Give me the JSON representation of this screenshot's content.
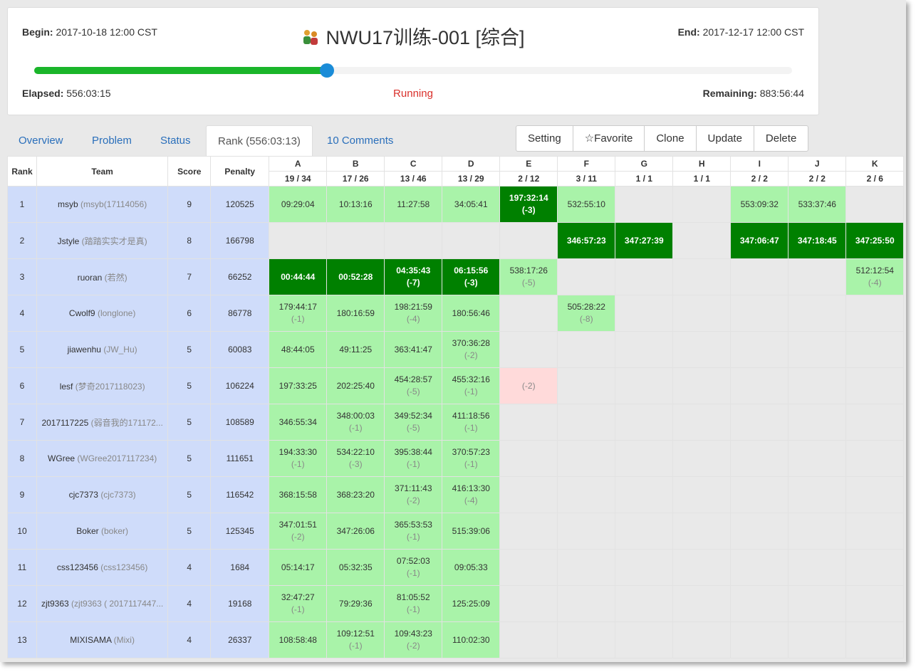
{
  "contest": {
    "title": "NWU17训练-001 [综合]",
    "begin_label": "Begin:",
    "begin": "2017-10-18 12:00 CST",
    "end_label": "End:",
    "end": "2017-12-17 12:00 CST",
    "elapsed_label": "Elapsed:",
    "elapsed": "556:03:15",
    "remaining_label": "Remaining:",
    "remaining": "883:56:44",
    "status": "Running",
    "progress": 0.386
  },
  "tabs": [
    {
      "label": "Overview"
    },
    {
      "label": "Problem"
    },
    {
      "label": "Status"
    },
    {
      "label": "Rank (556:03:13)"
    },
    {
      "label": "10 Comments"
    }
  ],
  "buttons": [
    {
      "label": "Setting"
    },
    {
      "label": "☆Favorite"
    },
    {
      "label": "Clone"
    },
    {
      "label": "Update"
    },
    {
      "label": "Delete"
    }
  ],
  "columns": {
    "rank": "Rank",
    "team": "Team",
    "score": "Score",
    "penalty": "Penalty"
  },
  "problems": [
    {
      "id": "A",
      "stat": "19 / 34"
    },
    {
      "id": "B",
      "stat": "17 / 26"
    },
    {
      "id": "C",
      "stat": "13 / 46"
    },
    {
      "id": "D",
      "stat": "13 / 29"
    },
    {
      "id": "E",
      "stat": "2 / 12"
    },
    {
      "id": "F",
      "stat": "3 / 11"
    },
    {
      "id": "G",
      "stat": "1 / 1"
    },
    {
      "id": "H",
      "stat": "1 / 1"
    },
    {
      "id": "I",
      "stat": "2 / 2"
    },
    {
      "id": "J",
      "stat": "2 / 2"
    },
    {
      "id": "K",
      "stat": "2 / 6"
    }
  ],
  "rows": [
    {
      "rank": "1",
      "user": "msyb",
      "nick": "(msyb(17114056)",
      "score": "9",
      "penalty": "120525",
      "cells": [
        [
          "ac",
          "09:29:04",
          ""
        ],
        [
          "ac",
          "10:13:16",
          ""
        ],
        [
          "ac",
          "11:27:58",
          ""
        ],
        [
          "ac",
          "34:05:41",
          ""
        ],
        [
          "fb",
          "197:32:14",
          "(-3)"
        ],
        [
          "ac",
          "532:55:10",
          ""
        ],
        [
          "",
          "",
          ""
        ],
        [
          "",
          "",
          ""
        ],
        [
          "ac",
          "553:09:32",
          ""
        ],
        [
          "ac",
          "533:37:46",
          ""
        ],
        [
          "",
          "",
          ""
        ]
      ]
    },
    {
      "rank": "2",
      "user": "Jstyle",
      "nick": "(踏踏实实才是真)",
      "score": "8",
      "penalty": "166798",
      "cells": [
        [
          "",
          "",
          ""
        ],
        [
          "",
          "",
          ""
        ],
        [
          "",
          "",
          ""
        ],
        [
          "",
          "",
          ""
        ],
        [
          "",
          "",
          ""
        ],
        [
          "fb",
          "346:57:23",
          ""
        ],
        [
          "fb",
          "347:27:39",
          ""
        ],
        [
          "",
          "",
          ""
        ],
        [
          "fb",
          "347:06:47",
          ""
        ],
        [
          "fb",
          "347:18:45",
          ""
        ],
        [
          "fb",
          "347:25:50",
          ""
        ]
      ]
    },
    {
      "rank": "3",
      "user": "ruoran",
      "nick": "(若然)",
      "score": "7",
      "penalty": "66252",
      "cells": [
        [
          "fb",
          "00:44:44",
          ""
        ],
        [
          "fb",
          "00:52:28",
          ""
        ],
        [
          "fb",
          "04:35:43",
          "(-7)"
        ],
        [
          "fb",
          "06:15:56",
          "(-3)"
        ],
        [
          "ac",
          "538:17:26",
          "(-5)"
        ],
        [
          "",
          "",
          ""
        ],
        [
          "",
          "",
          ""
        ],
        [
          "",
          "",
          ""
        ],
        [
          "",
          "",
          ""
        ],
        [
          "",
          "",
          ""
        ],
        [
          "ac",
          "512:12:54",
          "(-4)"
        ]
      ]
    },
    {
      "rank": "4",
      "user": "Cwolf9",
      "nick": "(longlone)",
      "score": "6",
      "penalty": "86778",
      "cells": [
        [
          "ac",
          "179:44:17",
          "(-1)"
        ],
        [
          "ac",
          "180:16:59",
          ""
        ],
        [
          "ac",
          "198:21:59",
          "(-4)"
        ],
        [
          "ac",
          "180:56:46",
          ""
        ],
        [
          "",
          "",
          ""
        ],
        [
          "ac",
          "505:28:22",
          "(-8)"
        ],
        [
          "",
          "",
          ""
        ],
        [
          "",
          "",
          ""
        ],
        [
          "",
          "",
          ""
        ],
        [
          "",
          "",
          ""
        ],
        [
          "",
          "",
          ""
        ]
      ]
    },
    {
      "rank": "5",
      "user": "jiawenhu",
      "nick": "(JW_Hu)",
      "score": "5",
      "penalty": "60083",
      "cells": [
        [
          "ac",
          "48:44:05",
          ""
        ],
        [
          "ac",
          "49:11:25",
          ""
        ],
        [
          "ac",
          "363:41:47",
          ""
        ],
        [
          "ac",
          "370:36:28",
          "(-2)"
        ],
        [
          "",
          "",
          ""
        ],
        [
          "",
          "",
          ""
        ],
        [
          "",
          "",
          ""
        ],
        [
          "",
          "",
          ""
        ],
        [
          "",
          "",
          ""
        ],
        [
          "",
          "",
          ""
        ],
        [
          "",
          "",
          ""
        ]
      ]
    },
    {
      "rank": "6",
      "user": "lesf",
      "nick": "(梦奇2017118023)",
      "score": "5",
      "penalty": "106224",
      "cells": [
        [
          "ac",
          "197:33:25",
          ""
        ],
        [
          "ac",
          "202:25:40",
          ""
        ],
        [
          "ac",
          "454:28:57",
          "(-5)"
        ],
        [
          "ac",
          "455:32:16",
          "(-1)"
        ],
        [
          "wa",
          "",
          "(-2)"
        ],
        [
          "",
          "",
          ""
        ],
        [
          "",
          "",
          ""
        ],
        [
          "",
          "",
          ""
        ],
        [
          "",
          "",
          ""
        ],
        [
          "",
          "",
          ""
        ],
        [
          "",
          "",
          ""
        ]
      ]
    },
    {
      "rank": "7",
      "user": "2017117225",
      "nick": "(弱音我的171172...",
      "score": "5",
      "penalty": "108589",
      "cells": [
        [
          "ac",
          "346:55:34",
          ""
        ],
        [
          "ac",
          "348:00:03",
          "(-1)"
        ],
        [
          "ac",
          "349:52:34",
          "(-5)"
        ],
        [
          "ac",
          "411:18:56",
          "(-1)"
        ],
        [
          "",
          "",
          ""
        ],
        [
          "",
          "",
          ""
        ],
        [
          "",
          "",
          ""
        ],
        [
          "",
          "",
          ""
        ],
        [
          "",
          "",
          ""
        ],
        [
          "",
          "",
          ""
        ],
        [
          "",
          "",
          ""
        ]
      ]
    },
    {
      "rank": "8",
      "user": "WGree",
      "nick": "(WGree2017117234)",
      "score": "5",
      "penalty": "111651",
      "cells": [
        [
          "ac",
          "194:33:30",
          "(-1)"
        ],
        [
          "ac",
          "534:22:10",
          "(-3)"
        ],
        [
          "ac",
          "395:38:44",
          "(-1)"
        ],
        [
          "ac",
          "370:57:23",
          "(-1)"
        ],
        [
          "",
          "",
          ""
        ],
        [
          "",
          "",
          ""
        ],
        [
          "",
          "",
          ""
        ],
        [
          "",
          "",
          ""
        ],
        [
          "",
          "",
          ""
        ],
        [
          "",
          "",
          ""
        ],
        [
          "",
          "",
          ""
        ]
      ]
    },
    {
      "rank": "9",
      "user": "cjc7373",
      "nick": "(cjc7373)",
      "score": "5",
      "penalty": "116542",
      "cells": [
        [
          "ac",
          "368:15:58",
          ""
        ],
        [
          "ac",
          "368:23:20",
          ""
        ],
        [
          "ac",
          "371:11:43",
          "(-2)"
        ],
        [
          "ac",
          "416:13:30",
          "(-4)"
        ],
        [
          "",
          "",
          ""
        ],
        [
          "",
          "",
          ""
        ],
        [
          "",
          "",
          ""
        ],
        [
          "",
          "",
          ""
        ],
        [
          "",
          "",
          ""
        ],
        [
          "",
          "",
          ""
        ],
        [
          "",
          "",
          ""
        ]
      ]
    },
    {
      "rank": "10",
      "user": "Boker",
      "nick": "(boker)",
      "score": "5",
      "penalty": "125345",
      "cells": [
        [
          "ac",
          "347:01:51",
          "(-2)"
        ],
        [
          "ac",
          "347:26:06",
          ""
        ],
        [
          "ac",
          "365:53:53",
          "(-1)"
        ],
        [
          "ac",
          "515:39:06",
          ""
        ],
        [
          "",
          "",
          ""
        ],
        [
          "",
          "",
          ""
        ],
        [
          "",
          "",
          ""
        ],
        [
          "",
          "",
          ""
        ],
        [
          "",
          "",
          ""
        ],
        [
          "",
          "",
          ""
        ],
        [
          "",
          "",
          ""
        ]
      ]
    },
    {
      "rank": "11",
      "user": "css123456",
      "nick": "(css123456)",
      "score": "4",
      "penalty": "1684",
      "cells": [
        [
          "ac",
          "05:14:17",
          ""
        ],
        [
          "ac",
          "05:32:35",
          ""
        ],
        [
          "ac",
          "07:52:03",
          "(-1)"
        ],
        [
          "ac",
          "09:05:33",
          ""
        ],
        [
          "",
          "",
          ""
        ],
        [
          "",
          "",
          ""
        ],
        [
          "",
          "",
          ""
        ],
        [
          "",
          "",
          ""
        ],
        [
          "",
          "",
          ""
        ],
        [
          "",
          "",
          ""
        ],
        [
          "",
          "",
          ""
        ]
      ]
    },
    {
      "rank": "12",
      "user": "zjt9363",
      "nick": "(zjt9363 ( 2017117447...",
      "score": "4",
      "penalty": "19168",
      "cells": [
        [
          "ac",
          "32:47:27",
          "(-1)"
        ],
        [
          "ac",
          "79:29:36",
          ""
        ],
        [
          "ac",
          "81:05:52",
          "(-1)"
        ],
        [
          "ac",
          "125:25:09",
          ""
        ],
        [
          "",
          "",
          ""
        ],
        [
          "",
          "",
          ""
        ],
        [
          "",
          "",
          ""
        ],
        [
          "",
          "",
          ""
        ],
        [
          "",
          "",
          ""
        ],
        [
          "",
          "",
          ""
        ],
        [
          "",
          "",
          ""
        ]
      ]
    },
    {
      "rank": "13",
      "user": "MIXISAMA",
      "nick": "(Mixi)",
      "score": "4",
      "penalty": "26337",
      "cells": [
        [
          "ac",
          "108:58:48",
          ""
        ],
        [
          "ac",
          "109:12:51",
          "(-1)"
        ],
        [
          "ac",
          "109:43:23",
          "(-2)"
        ],
        [
          "ac",
          "110:02:30",
          ""
        ],
        [
          "",
          "",
          ""
        ],
        [
          "",
          "",
          ""
        ],
        [
          "",
          "",
          ""
        ],
        [
          "",
          "",
          ""
        ],
        [
          "",
          "",
          ""
        ],
        [
          "",
          "",
          ""
        ],
        [
          "",
          "",
          ""
        ]
      ]
    }
  ]
}
